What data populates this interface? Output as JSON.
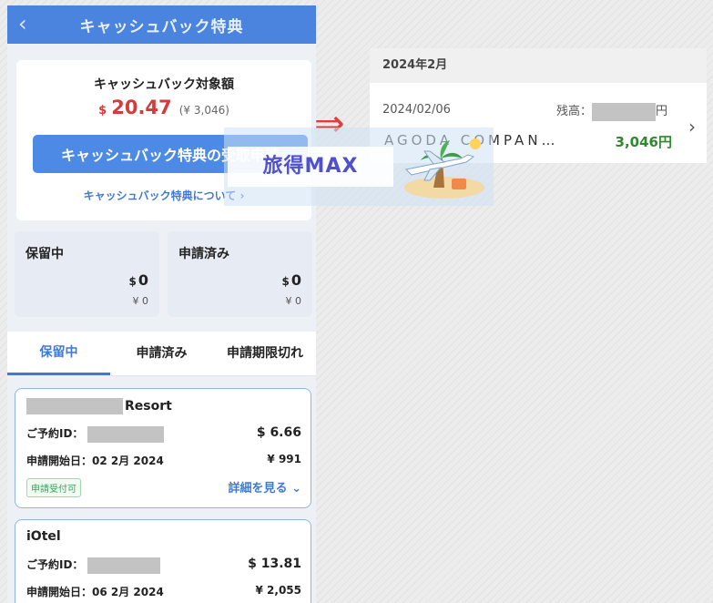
{
  "header": {
    "back_icon": "‹",
    "title": "キャッシュバック特典"
  },
  "summary": {
    "label": "キャッシュバック対象額",
    "currency": "$",
    "amount_usd": "20.47",
    "amount_jpy": "(¥ 3,046)",
    "claim_button": "キャッシュバック特典の受取申請",
    "about_link": "キャッシュバック特典について"
  },
  "stats": [
    {
      "label": "保留中",
      "usd": "0",
      "jpy": "¥ 0"
    },
    {
      "label": "申請済み",
      "usd": "0",
      "jpy": "¥ 0"
    }
  ],
  "tabs": [
    "保留中",
    "申請済み",
    "申請期限切れ"
  ],
  "bookings": [
    {
      "name": "Resort",
      "id_label": "ご予約ID：",
      "usd": "$ 6.66",
      "date_label": "申請開始日：02 2月 2024",
      "jpy": "¥ 991",
      "badge": "申請受付可",
      "detail": "詳細を見る"
    },
    {
      "name": "iOtel",
      "id_label": "ご予約ID：",
      "usd": "$ 13.81",
      "date_label": "申請開始日：06 2月 2024",
      "jpy": "¥ 2,055"
    }
  ],
  "statement": {
    "month": "2024年2月",
    "date": "2024/02/06",
    "balance_label": "残高：",
    "balance_suffix": "円",
    "description": "AGODA COMPAN…",
    "amount": "3,046円"
  },
  "watermark": {
    "text": "旅得MAX"
  },
  "colors": {
    "accent": "#4b84df",
    "amount_red": "#d63b3b",
    "credit_green": "#2f8a2f"
  }
}
